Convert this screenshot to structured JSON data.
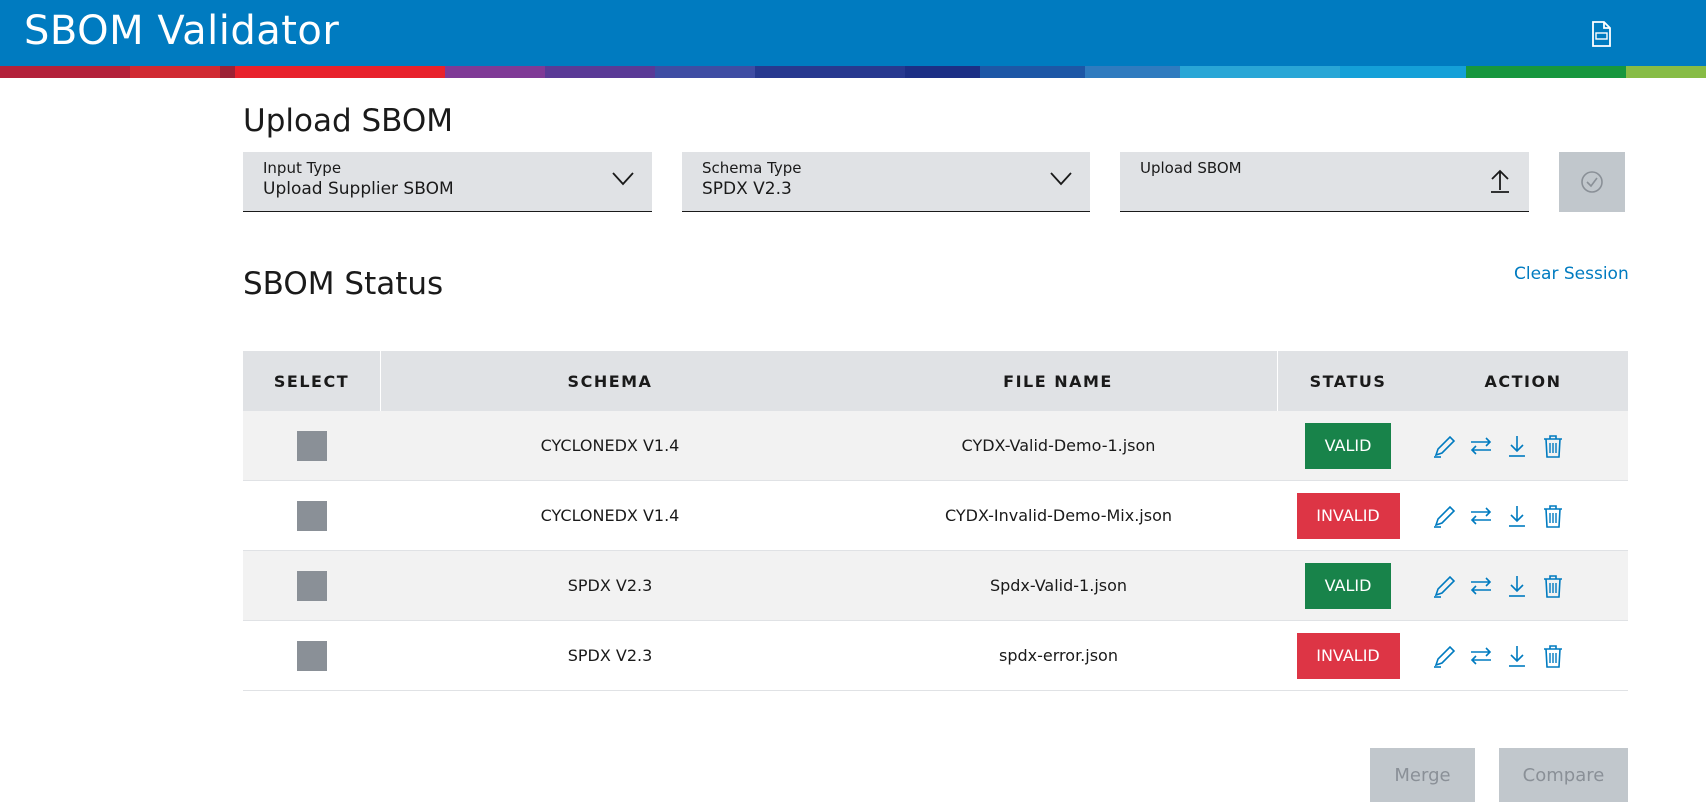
{
  "header": {
    "title": "SBOM Validator",
    "icon": "document-icon",
    "color": "#007bc0"
  },
  "upload": {
    "section_title": "Upload SBOM",
    "input_type": {
      "label": "Input Type",
      "value": "Upload Supplier SBOM"
    },
    "schema_type": {
      "label": "Schema Type",
      "value": "SPDX V2.3"
    },
    "file": {
      "label": "Upload SBOM"
    }
  },
  "status": {
    "section_title": "SBOM Status",
    "clear_label": "Clear Session"
  },
  "table": {
    "headers": {
      "select": "SELECT",
      "schema": "SCHEMA",
      "file_name": "FILE NAME",
      "status": "STATUS",
      "action": "ACTION"
    },
    "rows": [
      {
        "schema": "CYCLONEDX V1.4",
        "file_name": "CYDX-Valid-Demo-1.json",
        "status": "VALID"
      },
      {
        "schema": "CYCLONEDX V1.4",
        "file_name": "CYDX-Invalid-Demo-Mix.json",
        "status": "INVALID"
      },
      {
        "schema": "SPDX V2.3",
        "file_name": "Spdx-Valid-1.json",
        "status": "VALID"
      },
      {
        "schema": "SPDX V2.3",
        "file_name": "spdx-error.json",
        "status": "INVALID"
      }
    ]
  },
  "buttons": {
    "merge": "Merge",
    "compare": "Compare"
  },
  "colors": {
    "primary": "#007bc0",
    "valid": "#18834a",
    "invalid": "#dd3545",
    "disabled": "#c1c7cc"
  }
}
